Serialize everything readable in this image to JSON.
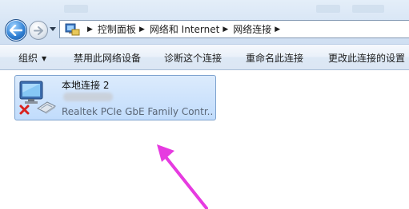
{
  "address_bar": {
    "breadcrumbs": [
      {
        "label": "控制面板"
      },
      {
        "label": "网络和 Internet"
      },
      {
        "label": "网络连接"
      }
    ],
    "icons": {
      "back": "back-arrow-icon",
      "forward": "forward-arrow-icon",
      "location": "network-folder-icon"
    }
  },
  "toolbar": {
    "organize_label": "组织",
    "disable_label": "禁用此网络设备",
    "diagnose_label": "诊断这个连接",
    "rename_label": "重命名此连接",
    "change_settings_label": "更改此连接的设置"
  },
  "connection": {
    "name": "本地连接 2",
    "device": "Realtek PCIe GbE Family Contr...",
    "status_icon": "disconnected-x-icon"
  },
  "annotation": {
    "color": "#e63be0"
  }
}
